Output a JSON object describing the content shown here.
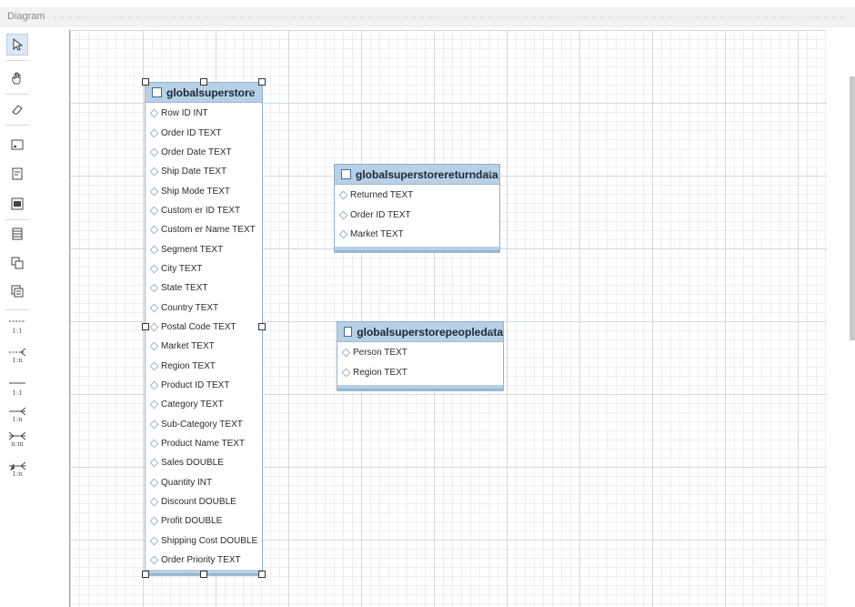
{
  "panel": {
    "title": "Diagram"
  },
  "toolbar": {
    "tools": [
      {
        "name": "pointer-icon"
      },
      {
        "name": "hand-icon"
      },
      {
        "name": "eraser-icon"
      },
      {
        "name": "layer-icon"
      },
      {
        "name": "note-icon"
      },
      {
        "name": "image-icon"
      },
      {
        "name": "table-icon"
      },
      {
        "name": "view-icon"
      },
      {
        "name": "routine-group-icon"
      }
    ],
    "relations": [
      {
        "label": "1:1",
        "name": "relation-1-1-non-identifying-icon"
      },
      {
        "label": "1:n",
        "name": "relation-1-n-non-identifying-icon"
      },
      {
        "label": "1:1",
        "name": "relation-1-1-identifying-icon"
      },
      {
        "label": "1:n",
        "name": "relation-1-n-identifying-icon"
      },
      {
        "label": "n:m",
        "name": "relation-n-m-identifying-icon"
      },
      {
        "label": "1:n",
        "name": "relation-1-n-existing-columns-icon"
      }
    ]
  },
  "tables": [
    {
      "name": "globalsuperstore",
      "columns": [
        "Row ID INT",
        "Order ID TEXT",
        "Order Date TEXT",
        "Ship Date TEXT",
        "Ship Mode TEXT",
        "Custom er ID TEXT",
        "Custom er Name TEXT",
        "Segment TEXT",
        "City TEXT",
        "State TEXT",
        "Country TEXT",
        "Postal Code TEXT",
        "Market TEXT",
        "Region TEXT",
        "Product ID TEXT",
        "Category TEXT",
        "Sub-Category TEXT",
        "Product Name TEXT",
        "Sales DOUBLE",
        "Quantity INT",
        "Discount DOUBLE",
        "Profit DOUBLE",
        "Shipping Cost DOUBLE",
        "Order Priority TEXT"
      ]
    },
    {
      "name": "globalsuperstorereturndata",
      "columns": [
        "Returned TEXT",
        "Order ID TEXT",
        "Market TEXT"
      ]
    },
    {
      "name": "globalsuperstorepeopledata",
      "columns": [
        "Person TEXT",
        "Region TEXT"
      ]
    }
  ],
  "colors": {
    "header": "#b7d0e6",
    "border": "#8fb1cc",
    "grid_major": "#d3d9df",
    "grid_minor": "#eceff2"
  }
}
